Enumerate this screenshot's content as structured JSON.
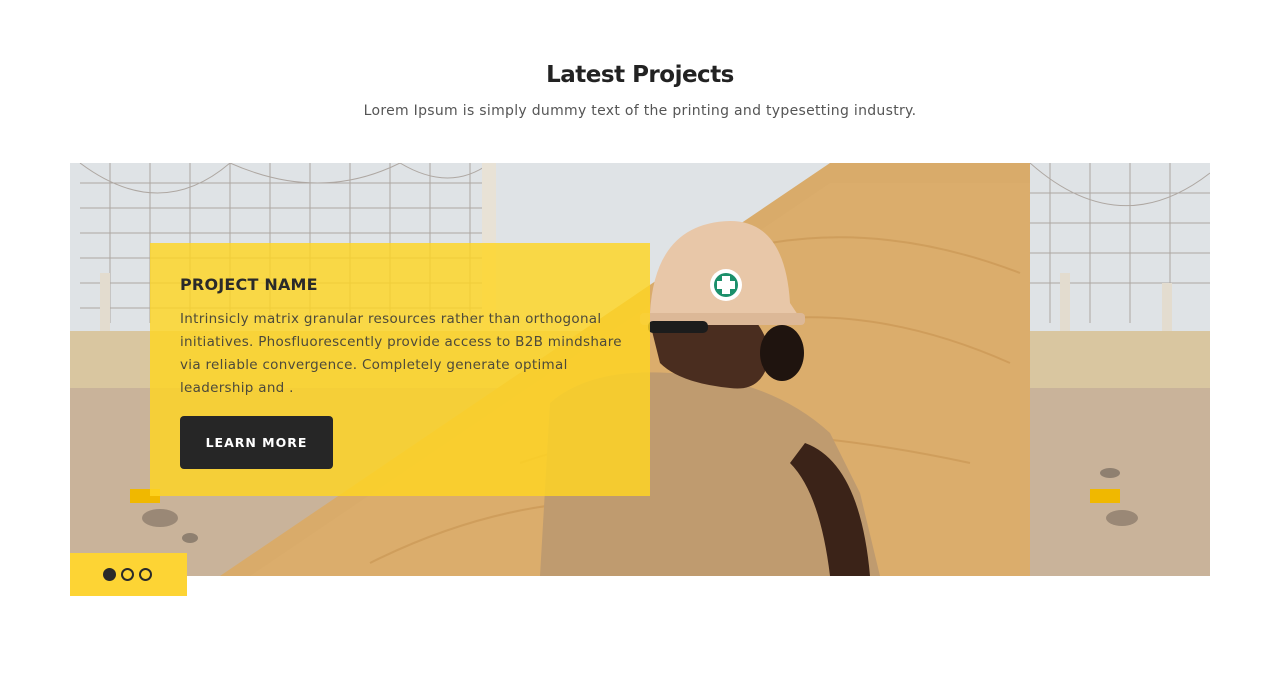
{
  "section": {
    "title": "Latest Projects",
    "subtitle": "Lorem Ipsum is simply dummy text of the printing and typesetting industry."
  },
  "slide": {
    "project_name": "PROJECT NAME",
    "description": "Intrinsicly matrix granular resources rather than orthogonal initiatives. Phosfluorescently provide access to B2B mindshare via reliable convergence. Completely generate optimal leadership and .",
    "button_label": "LEARN MORE",
    "image": "construction-worker-carrying-plywood-photo"
  },
  "pagination": {
    "count": 3,
    "active_index": 0
  },
  "colors": {
    "accent": "#fdd434",
    "button": "#262626",
    "title": "#222222"
  }
}
